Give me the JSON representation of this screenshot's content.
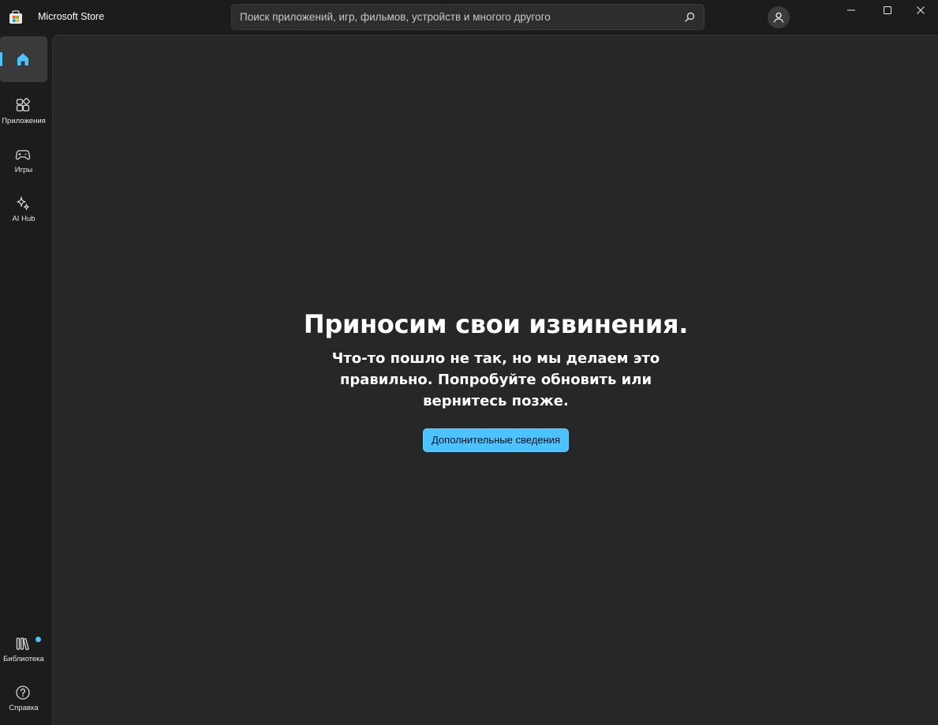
{
  "app": {
    "title": "Microsoft Store",
    "logo_icon": "store-logo-icon"
  },
  "search": {
    "placeholder": "Поиск приложений, игр, фильмов, устройств и многого другого",
    "value": "",
    "icon": "search-icon"
  },
  "window_controls": [
    "minimize-icon",
    "maximize-icon",
    "close-icon"
  ],
  "sidebar": {
    "items": [
      {
        "label": "",
        "icon": "home-icon",
        "selected": true
      },
      {
        "label": "Приложения",
        "icon": "apps-icon"
      },
      {
        "label": "Игры",
        "icon": "gamepad-icon"
      },
      {
        "label": "AI Hub",
        "icon": "sparkle-icon"
      }
    ],
    "bottom_items": [
      {
        "label": "Библиотека",
        "icon": "library-icon",
        "has_badge": true
      },
      {
        "label": "Справка",
        "icon": "help-icon"
      }
    ]
  },
  "error": {
    "title": "Приносим свои извинения.",
    "message": "Что-то пошло не так, но мы делаем это правильно. Попробуйте обновить или вернитесь позже.",
    "button_label": "Дополнительные сведения"
  },
  "colors": {
    "accent": "#4cc2ff",
    "background": "#1c1c1c",
    "content_background": "#272727"
  }
}
